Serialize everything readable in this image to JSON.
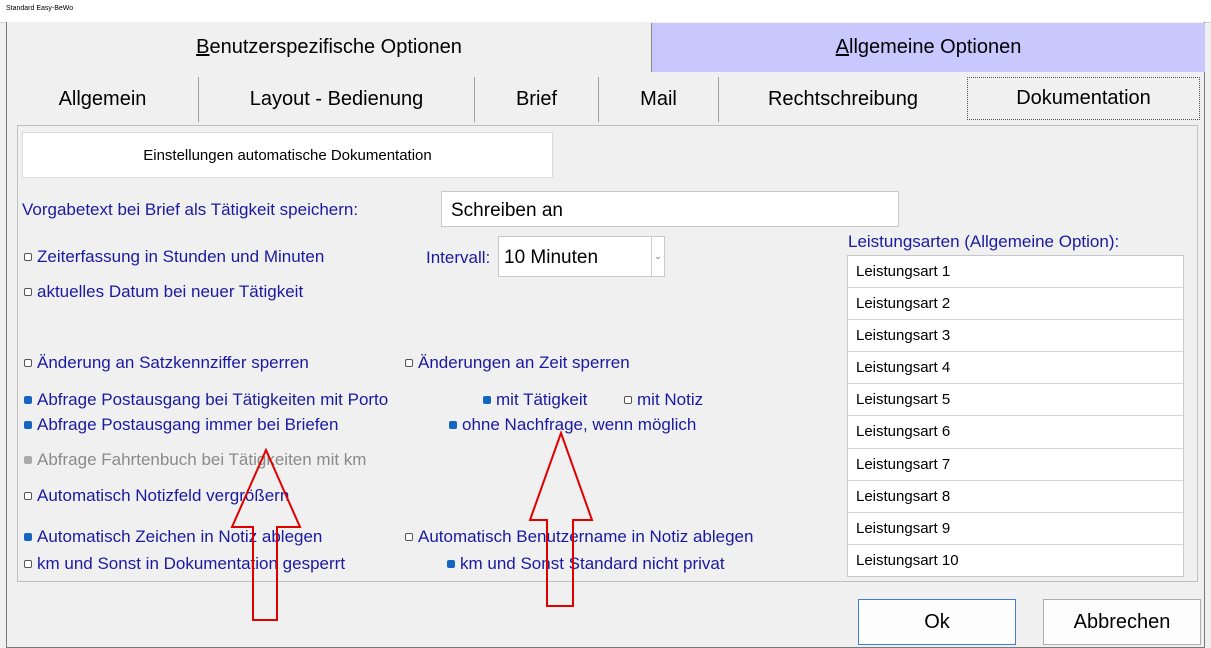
{
  "window": {
    "title": "Standard Easy-BeWo"
  },
  "main_tabs": [
    {
      "label": "Benutzerspezifische Optionen",
      "mnemonic_prefix": "",
      "mnemonic": "B",
      "rest": "enutzerspezifische Optionen"
    },
    {
      "label": "Allgemeine Optionen",
      "mnemonic": "A",
      "rest": "llgemeine Optionen"
    }
  ],
  "sub_tabs": [
    "Allgemein",
    "Layout - Bedienung",
    "Brief",
    "Mail",
    "Rechtschreibung",
    "Dokumentation"
  ],
  "active_sub_tab": "Dokumentation",
  "section_button": "Einstellungen automatische Dokumentation",
  "vorgabetext": {
    "label": "Vorgabetext bei Brief als Tätigkeit speichern:",
    "value": "Schreiben an"
  },
  "interval": {
    "label": "Intervall:",
    "value": "10 Minuten"
  },
  "options": {
    "zeiterfassung": {
      "label": "Zeiterfassung in Stunden und Minuten",
      "checked": false
    },
    "aktuelles_datum": {
      "label": "aktuelles Datum bei neuer Tätigkeit",
      "checked": false
    },
    "satzkennziffer": {
      "label": "Änderung an Satzkennziffer sperren",
      "checked": false
    },
    "zeit_sperren": {
      "label": "Änderungen an Zeit sperren",
      "checked": false
    },
    "postausgang_porto": {
      "label": "Abfrage Postausgang bei Tätigkeiten mit Porto",
      "checked": true
    },
    "mit_taetigkeit": {
      "label": "mit Tätigkeit",
      "checked": true
    },
    "mit_notiz": {
      "label": "mit Notiz",
      "checked": false
    },
    "postausgang_briefe": {
      "label": "Abfrage Postausgang immer bei Briefen",
      "checked": true
    },
    "ohne_nachfrage": {
      "label": "ohne Nachfrage, wenn möglich",
      "checked": true
    },
    "fahrtenbuch": {
      "label": "Abfrage Fahrtenbuch bei Tätigkeiten mit km",
      "checked": false,
      "disabled": true
    },
    "notizfeld": {
      "label": "Automatisch Notizfeld vergrößern",
      "checked": false
    },
    "zeichen_notiz": {
      "label": "Automatisch Zeichen in Notiz ablegen",
      "checked": true
    },
    "benutzername_notiz": {
      "label": "Automatisch Benutzername in Notiz ablegen",
      "checked": false
    },
    "km_gesperrt": {
      "label": "km und Sonst in Dokumentation gesperrt",
      "checked": false
    },
    "km_privat": {
      "label": "km und Sonst Standard nicht privat",
      "checked": true
    }
  },
  "leistungsarten": {
    "title": "Leistungsarten (Allgemeine Option):",
    "items": [
      "Leistungsart 1",
      "Leistungsart 2",
      "Leistungsart 3",
      "Leistungsart 4",
      "Leistungsart 5",
      "Leistungsart 6",
      "Leistungsart 7",
      "Leistungsart 8",
      "Leistungsart 9",
      "Leistungsart 10"
    ]
  },
  "buttons": {
    "ok": "Ok",
    "cancel": "Abbrechen"
  },
  "colors": {
    "active_tab": "#c8c8ff",
    "label_text": "#1a1aa0",
    "arrow": "#e00000"
  }
}
